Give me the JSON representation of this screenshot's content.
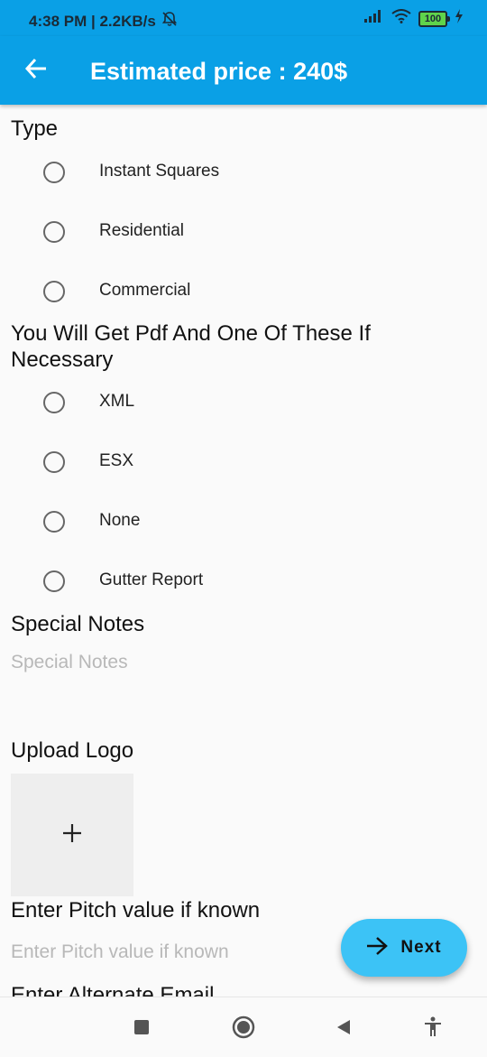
{
  "status": {
    "time_speed": "4:38 PM | 2.2KB/s",
    "battery": "100",
    "icons": [
      "alarm-off-icon",
      "signal-icon",
      "wifi-icon",
      "battery-icon",
      "charging-icon"
    ]
  },
  "appbar": {
    "title": "Estimated price : 240$",
    "back_icon": "arrow-left-icon",
    "background": "#0aa0e6"
  },
  "type_section": {
    "title": "Type",
    "options": [
      {
        "label": "Instant Squares",
        "selected": false
      },
      {
        "label": "Residential",
        "selected": false
      },
      {
        "label": "Commercial",
        "selected": false
      }
    ]
  },
  "format_section": {
    "title": "You Will Get Pdf And One Of These If Necessary",
    "options": [
      {
        "label": "XML",
        "selected": false
      },
      {
        "label": "ESX",
        "selected": false
      },
      {
        "label": "None",
        "selected": false
      },
      {
        "label": "Gutter Report",
        "selected": false
      }
    ]
  },
  "notes": {
    "title": "Special Notes",
    "placeholder": "Special Notes",
    "value": ""
  },
  "logo": {
    "title": "Upload Logo",
    "add_icon": "plus-icon"
  },
  "pitch": {
    "title": "Enter Pitch value if known",
    "placeholder": "Enter Pitch value if known",
    "value": ""
  },
  "alt_email": {
    "title": "Enter Alternate Email"
  },
  "fab": {
    "label": "Next",
    "icon": "arrow-right-icon",
    "color": "#3cc3f6"
  },
  "navbar": {
    "icons": [
      "recents-square-icon",
      "home-circle-icon",
      "back-triangle-icon",
      "accessibility-icon"
    ]
  }
}
